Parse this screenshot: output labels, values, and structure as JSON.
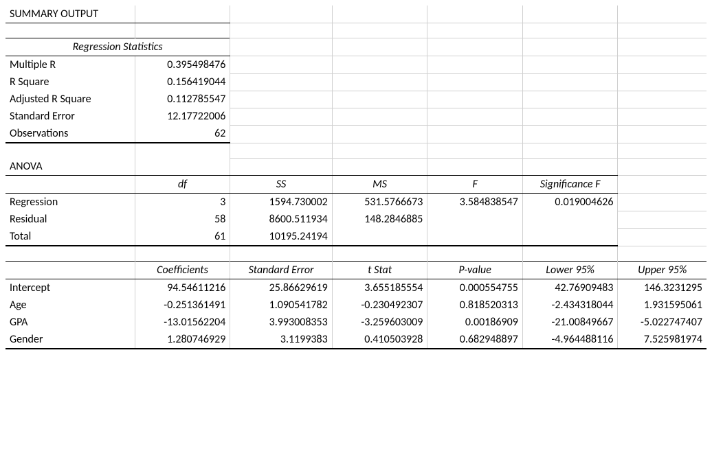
{
  "title": "SUMMARY OUTPUT",
  "reg_stats": {
    "heading": "Regression Statistics",
    "rows": {
      "multiple_r": {
        "label": "Multiple R",
        "value": "0.395498476"
      },
      "r_square": {
        "label": "R Square",
        "value": "0.156419044"
      },
      "adj_r_square": {
        "label": "Adjusted R Square",
        "value": "0.112785547"
      },
      "std_error": {
        "label": "Standard Error",
        "value": "12.17722006"
      },
      "observations": {
        "label": "Observations",
        "value": "62"
      }
    }
  },
  "anova": {
    "heading": "ANOVA",
    "columns": {
      "df": "df",
      "ss": "SS",
      "ms": "MS",
      "f": "F",
      "sig_f": "Significance F"
    },
    "rows": {
      "regression": {
        "label": "Regression",
        "df": "3",
        "ss": "1594.730002",
        "ms": "531.5766673",
        "f": "3.584838547",
        "sig_f": "0.019004626"
      },
      "residual": {
        "label": "Residual",
        "df": "58",
        "ss": "8600.511934",
        "ms": "148.2846885",
        "f": "",
        "sig_f": ""
      },
      "total": {
        "label": "Total",
        "df": "61",
        "ss": "10195.24194",
        "ms": "",
        "f": "",
        "sig_f": ""
      }
    }
  },
  "coeffs": {
    "columns": {
      "coef": "Coefficients",
      "se": "Standard Error",
      "t": "t Stat",
      "p": "P-value",
      "lo": "Lower 95%",
      "hi": "Upper 95%"
    },
    "rows": {
      "intercept": {
        "label": "Intercept",
        "coef": "94.54611216",
        "se": "25.86629619",
        "t": "3.655185554",
        "p": "0.000554755",
        "lo": "42.76909483",
        "hi": "146.3231295"
      },
      "age": {
        "label": "Age",
        "coef": "-0.251361491",
        "se": "1.090541782",
        "t": "-0.230492307",
        "p": "0.818520313",
        "lo": "-2.434318044",
        "hi": "1.931595061"
      },
      "gpa": {
        "label": "GPA",
        "coef": "-13.01562204",
        "se": "3.993008353",
        "t": "-3.259603009",
        "p": "0.00186909",
        "lo": "-21.00849667",
        "hi": "-5.022747407"
      },
      "gender": {
        "label": "Gender",
        "coef": "1.280746929",
        "se": "3.1199383",
        "t": "0.410503928",
        "p": "0.682948897",
        "lo": "-4.964488116",
        "hi": "7.525981974"
      }
    }
  }
}
